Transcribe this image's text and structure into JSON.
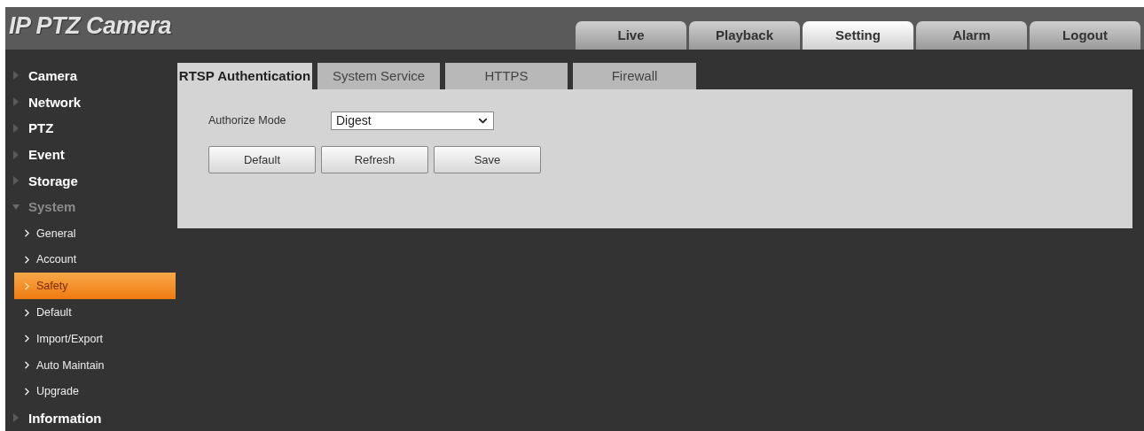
{
  "header": {
    "title": "IP PTZ Camera"
  },
  "nav_tabs": [
    {
      "label": "Live",
      "selected": false
    },
    {
      "label": "Playback",
      "selected": false
    },
    {
      "label": "Setting",
      "selected": true
    },
    {
      "label": "Alarm",
      "selected": false
    },
    {
      "label": "Logout",
      "selected": false
    }
  ],
  "sidebar": {
    "items": [
      {
        "label": "Camera",
        "expanded": false
      },
      {
        "label": "Network",
        "expanded": false
      },
      {
        "label": "PTZ",
        "expanded": false
      },
      {
        "label": "Event",
        "expanded": false
      },
      {
        "label": "Storage",
        "expanded": false
      },
      {
        "label": "System",
        "expanded": true,
        "children": [
          {
            "label": "General",
            "selected": false
          },
          {
            "label": "Account",
            "selected": false
          },
          {
            "label": "Safety",
            "selected": true
          },
          {
            "label": "Default",
            "selected": false
          },
          {
            "label": "Import/Export",
            "selected": false
          },
          {
            "label": "Auto Maintain",
            "selected": false
          },
          {
            "label": "Upgrade",
            "selected": false
          }
        ]
      },
      {
        "label": "Information",
        "expanded": false
      }
    ]
  },
  "tabs": [
    {
      "label": "RTSP Authentication",
      "selected": true
    },
    {
      "label": "System Service",
      "selected": false
    },
    {
      "label": "HTTPS",
      "selected": false
    },
    {
      "label": "Firewall",
      "selected": false
    }
  ],
  "form": {
    "label": "Authorize Mode",
    "value": "Digest"
  },
  "buttons": [
    "Default",
    "Refresh",
    "Save"
  ]
}
